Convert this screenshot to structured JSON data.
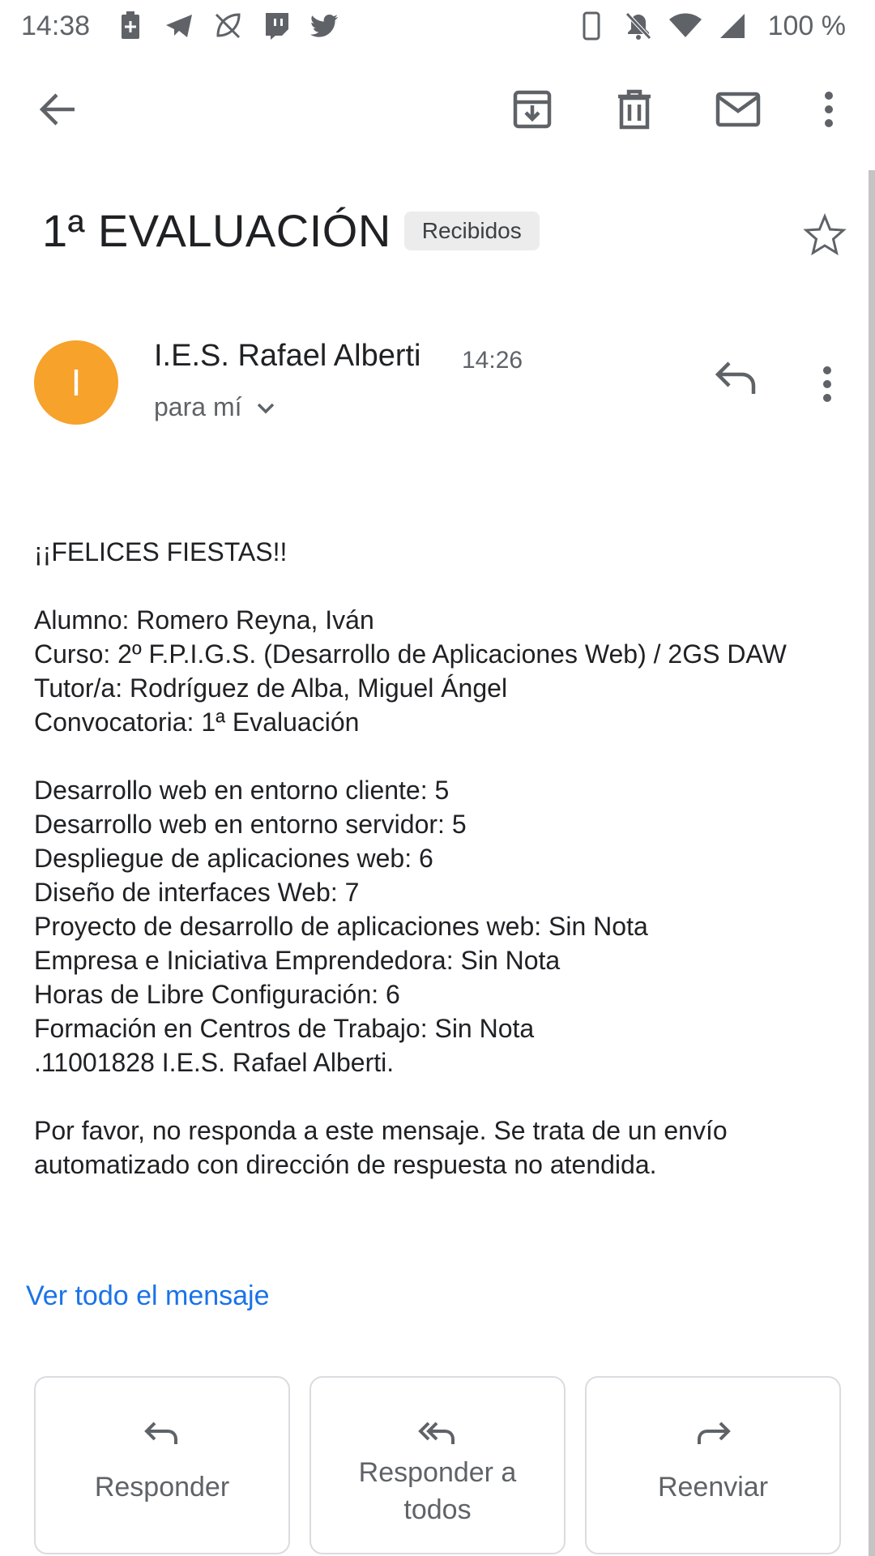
{
  "status_bar": {
    "time": "14:38",
    "battery_percent": "100 %",
    "left_icons": [
      "battery-saver-icon",
      "telegram-icon",
      "leaf-app-icon",
      "twitch-icon",
      "twitter-icon"
    ],
    "right_icons": [
      "phone-vibrate-icon",
      "notifications-off-icon",
      "wifi-icon",
      "signal-icon"
    ]
  },
  "toolbar": {
    "icons": [
      "back-arrow-icon",
      "archive-icon",
      "delete-icon",
      "mark-unread-icon",
      "more-vert-icon"
    ]
  },
  "email": {
    "subject": "1ª EVALUACIÓN",
    "label": "Recibidos",
    "sender_initial": "I",
    "sender_name": "I.E.S. Rafael Alberti",
    "time": "14:26",
    "recipient": "para mí",
    "avatar_color": "#f6a22b",
    "body": {
      "greeting": "¡¡FELICES FIESTAS!!",
      "student": "Alumno: Romero Reyna, Iván",
      "course": "Curso: 2º F.P.I.G.S. (Desarrollo de Aplicaciones Web) / 2GS DAW",
      "tutor": "Tutor/a: Rodríguez de Alba, Miguel Ángel",
      "session": "Convocatoria: 1ª Evaluación",
      "grades": [
        "Desarrollo web en entorno cliente: 5",
        "Desarrollo web en entorno servidor: 5",
        "Despliegue de aplicaciones web: 6",
        "Diseño de interfaces Web: 7",
        "Proyecto de desarrollo de aplicaciones web: Sin Nota",
        "Empresa e Iniciativa Emprendedora: Sin Nota",
        "Horas de Libre Configuración: 6",
        "Formación en Centros de Trabajo: Sin Nota"
      ],
      "signature": ".11001828 I.E.S. Rafael Alberti.",
      "footer": "Por favor, no responda a este mensaje. Se trata de un envío automatizado con dirección de respuesta no atendida."
    },
    "view_all": "Ver todo el mensaje"
  },
  "actions": {
    "reply": "Responder",
    "reply_all": "Responder a todos",
    "forward": "Reenviar"
  },
  "colors": {
    "link": "#1a73e8",
    "text": "#202124",
    "secondary": "#5f6368"
  }
}
